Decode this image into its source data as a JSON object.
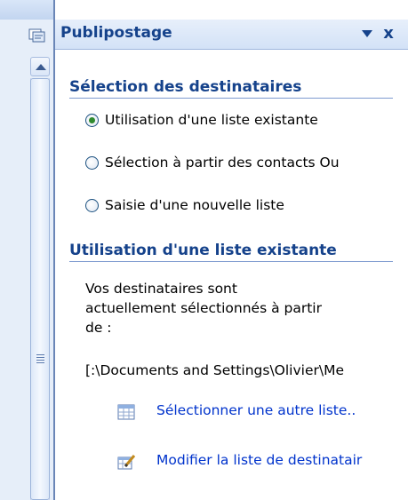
{
  "pane": {
    "title": "Publipostage",
    "dropdown_icon": "dropdown-arrow-icon",
    "close_label": "x"
  },
  "recipients": {
    "heading": "Sélection des destinataires",
    "options": [
      {
        "label": "Utilisation d'une liste existante",
        "checked": true
      },
      {
        "label": "Sélection à partir des contacts Ou",
        "checked": false
      },
      {
        "label": "Saisie d'une nouvelle liste",
        "checked": false
      }
    ]
  },
  "existing_list": {
    "heading": "Utilisation d'une liste existante",
    "description_lines": [
      "Vos destinataires sont",
      "actuellement sélectionnés à partir",
      "de :"
    ],
    "path": "[:\\Documents and Settings\\Olivier\\Me",
    "actions": [
      {
        "label": "Sélectionner une autre liste..",
        "icon": "table-list-icon"
      },
      {
        "label": "Modifier la liste de destinatair",
        "icon": "edit-list-icon"
      }
    ]
  },
  "colors": {
    "heading": "#15428b",
    "link": "#0033cc",
    "pane_border": "#6a86b7",
    "titlebar_start": "#e7effb",
    "titlebar_end": "#d3e2f7"
  }
}
